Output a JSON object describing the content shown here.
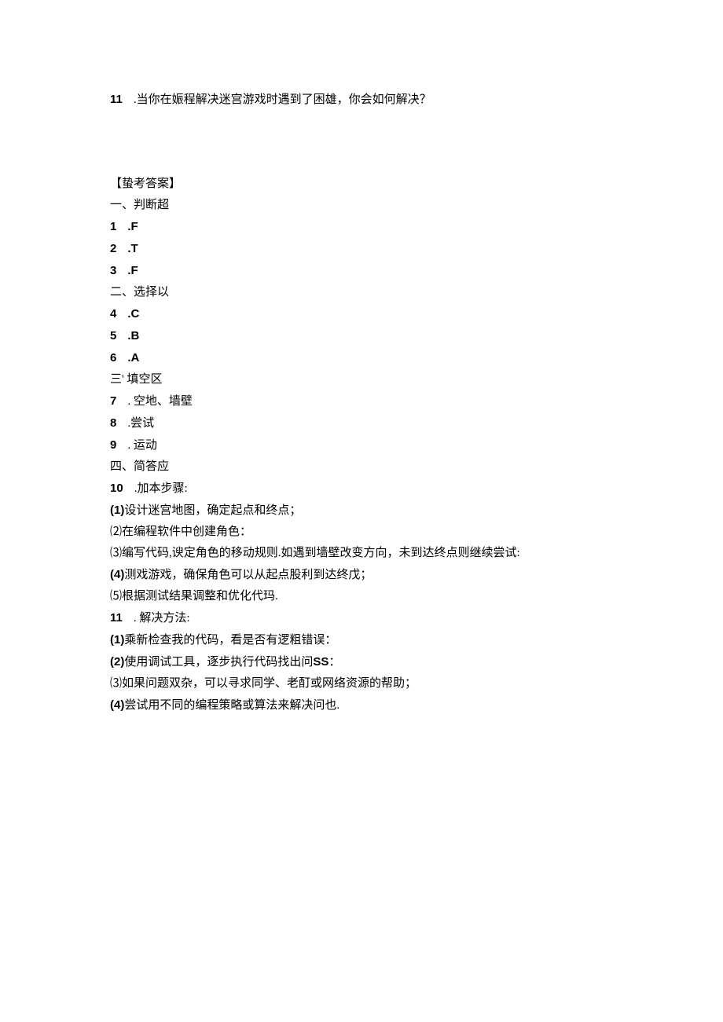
{
  "q11": {
    "num": "11",
    "text": ".当你在娠程解决迷宫游戏时遇到了困雄，你会如何解决？"
  },
  "answer_header": "【蛰考答案】",
  "sec1": {
    "title": "一、判断超",
    "items": [
      {
        "num": "1",
        "val": ".F"
      },
      {
        "num": "2",
        "val": ".T"
      },
      {
        "num": "3",
        "val": ".F"
      }
    ]
  },
  "sec2": {
    "title": "二、选择以",
    "items": [
      {
        "num": "4",
        "val": ".C"
      },
      {
        "num": "5",
        "val": ".B"
      },
      {
        "num": "6",
        "val": ".A"
      }
    ]
  },
  "sec3": {
    "title": "三' 填空区",
    "items": [
      {
        "num": "7",
        "val": ". 空地、墙壁"
      },
      {
        "num": "8",
        "val": ".尝试"
      },
      {
        "num": "9",
        "val": ". 运动"
      }
    ]
  },
  "sec4": {
    "title": "四、简答应",
    "q10": {
      "num": "10",
      "header": ".加本步骤:",
      "lines": [
        {
          "num": "(1)",
          "text": "设计迷宫地图，确定起点和终点；"
        },
        {
          "num": "⑵",
          "text": "在编程软件中创建角色："
        },
        {
          "num": "⑶",
          "text": "编写代码,谀定角色的移动规则.如遇到墙壁改变方向，未到达终点则继续尝试:"
        },
        {
          "num": "(4)",
          "text": "测戏游戏，确保角色可以从起点股利到达终戊；"
        },
        {
          "num": "⑸",
          "text": "根据测试结果调整和优化代玛."
        }
      ]
    },
    "q11": {
      "num": "11",
      "header": ". 解决方法:",
      "lines": [
        {
          "num": "(1)",
          "text": "乘新检查我的代码，看是否有逻粗错误："
        },
        {
          "num": "(2)",
          "text": "使用调试工具，逐步执行代码找出问",
          "tail": "SS",
          "suffix": "："
        },
        {
          "num": "⑶",
          "text": "如果问题双杂，可以寻求同学、老酊或网络资源的帮助；"
        },
        {
          "num": "(4)",
          "text": "尝试用不同的编程策略或算法来解决问也."
        }
      ]
    }
  }
}
